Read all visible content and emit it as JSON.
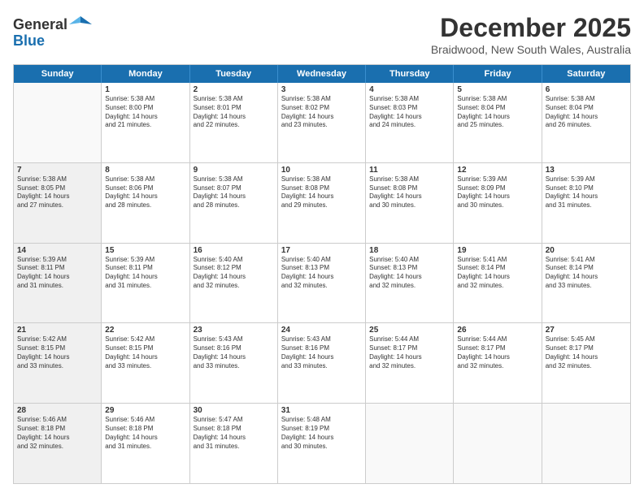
{
  "logo": {
    "line1": "General",
    "line2": "Blue"
  },
  "title": "December 2025",
  "subtitle": "Braidwood, New South Wales, Australia",
  "days": [
    "Sunday",
    "Monday",
    "Tuesday",
    "Wednesday",
    "Thursday",
    "Friday",
    "Saturday"
  ],
  "weeks": [
    [
      {
        "day": "",
        "info": ""
      },
      {
        "day": "1",
        "info": "Sunrise: 5:38 AM\nSunset: 8:00 PM\nDaylight: 14 hours\nand 21 minutes."
      },
      {
        "day": "2",
        "info": "Sunrise: 5:38 AM\nSunset: 8:01 PM\nDaylight: 14 hours\nand 22 minutes."
      },
      {
        "day": "3",
        "info": "Sunrise: 5:38 AM\nSunset: 8:02 PM\nDaylight: 14 hours\nand 23 minutes."
      },
      {
        "day": "4",
        "info": "Sunrise: 5:38 AM\nSunset: 8:03 PM\nDaylight: 14 hours\nand 24 minutes."
      },
      {
        "day": "5",
        "info": "Sunrise: 5:38 AM\nSunset: 8:04 PM\nDaylight: 14 hours\nand 25 minutes."
      },
      {
        "day": "6",
        "info": "Sunrise: 5:38 AM\nSunset: 8:04 PM\nDaylight: 14 hours\nand 26 minutes."
      }
    ],
    [
      {
        "day": "7",
        "info": "Sunrise: 5:38 AM\nSunset: 8:05 PM\nDaylight: 14 hours\nand 27 minutes."
      },
      {
        "day": "8",
        "info": "Sunrise: 5:38 AM\nSunset: 8:06 PM\nDaylight: 14 hours\nand 28 minutes."
      },
      {
        "day": "9",
        "info": "Sunrise: 5:38 AM\nSunset: 8:07 PM\nDaylight: 14 hours\nand 28 minutes."
      },
      {
        "day": "10",
        "info": "Sunrise: 5:38 AM\nSunset: 8:08 PM\nDaylight: 14 hours\nand 29 minutes."
      },
      {
        "day": "11",
        "info": "Sunrise: 5:38 AM\nSunset: 8:08 PM\nDaylight: 14 hours\nand 30 minutes."
      },
      {
        "day": "12",
        "info": "Sunrise: 5:39 AM\nSunset: 8:09 PM\nDaylight: 14 hours\nand 30 minutes."
      },
      {
        "day": "13",
        "info": "Sunrise: 5:39 AM\nSunset: 8:10 PM\nDaylight: 14 hours\nand 31 minutes."
      }
    ],
    [
      {
        "day": "14",
        "info": "Sunrise: 5:39 AM\nSunset: 8:11 PM\nDaylight: 14 hours\nand 31 minutes."
      },
      {
        "day": "15",
        "info": "Sunrise: 5:39 AM\nSunset: 8:11 PM\nDaylight: 14 hours\nand 31 minutes."
      },
      {
        "day": "16",
        "info": "Sunrise: 5:40 AM\nSunset: 8:12 PM\nDaylight: 14 hours\nand 32 minutes."
      },
      {
        "day": "17",
        "info": "Sunrise: 5:40 AM\nSunset: 8:13 PM\nDaylight: 14 hours\nand 32 minutes."
      },
      {
        "day": "18",
        "info": "Sunrise: 5:40 AM\nSunset: 8:13 PM\nDaylight: 14 hours\nand 32 minutes."
      },
      {
        "day": "19",
        "info": "Sunrise: 5:41 AM\nSunset: 8:14 PM\nDaylight: 14 hours\nand 32 minutes."
      },
      {
        "day": "20",
        "info": "Sunrise: 5:41 AM\nSunset: 8:14 PM\nDaylight: 14 hours\nand 33 minutes."
      }
    ],
    [
      {
        "day": "21",
        "info": "Sunrise: 5:42 AM\nSunset: 8:15 PM\nDaylight: 14 hours\nand 33 minutes."
      },
      {
        "day": "22",
        "info": "Sunrise: 5:42 AM\nSunset: 8:15 PM\nDaylight: 14 hours\nand 33 minutes."
      },
      {
        "day": "23",
        "info": "Sunrise: 5:43 AM\nSunset: 8:16 PM\nDaylight: 14 hours\nand 33 minutes."
      },
      {
        "day": "24",
        "info": "Sunrise: 5:43 AM\nSunset: 8:16 PM\nDaylight: 14 hours\nand 33 minutes."
      },
      {
        "day": "25",
        "info": "Sunrise: 5:44 AM\nSunset: 8:17 PM\nDaylight: 14 hours\nand 32 minutes."
      },
      {
        "day": "26",
        "info": "Sunrise: 5:44 AM\nSunset: 8:17 PM\nDaylight: 14 hours\nand 32 minutes."
      },
      {
        "day": "27",
        "info": "Sunrise: 5:45 AM\nSunset: 8:17 PM\nDaylight: 14 hours\nand 32 minutes."
      }
    ],
    [
      {
        "day": "28",
        "info": "Sunrise: 5:46 AM\nSunset: 8:18 PM\nDaylight: 14 hours\nand 32 minutes."
      },
      {
        "day": "29",
        "info": "Sunrise: 5:46 AM\nSunset: 8:18 PM\nDaylight: 14 hours\nand 31 minutes."
      },
      {
        "day": "30",
        "info": "Sunrise: 5:47 AM\nSunset: 8:18 PM\nDaylight: 14 hours\nand 31 minutes."
      },
      {
        "day": "31",
        "info": "Sunrise: 5:48 AM\nSunset: 8:19 PM\nDaylight: 14 hours\nand 30 minutes."
      },
      {
        "day": "",
        "info": ""
      },
      {
        "day": "",
        "info": ""
      },
      {
        "day": "",
        "info": ""
      }
    ]
  ]
}
